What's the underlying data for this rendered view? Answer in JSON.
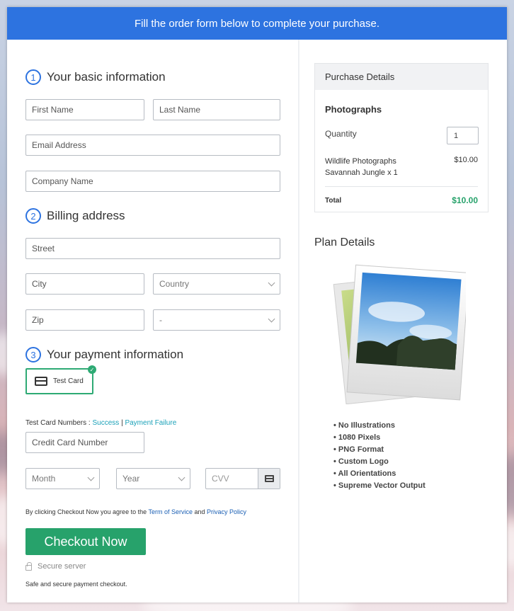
{
  "banner": {
    "text": "Fill the order form below to complete your purchase."
  },
  "sections": {
    "basic": {
      "num": "1",
      "title": "Your basic information"
    },
    "billing": {
      "num": "2",
      "title": "Billing address"
    },
    "payment": {
      "num": "3",
      "title": "Your payment information"
    }
  },
  "fields": {
    "first_name": "First Name",
    "last_name": "Last Name",
    "email": "Email Address",
    "company": "Company Name",
    "street": "Street",
    "city": "City",
    "country": "Country",
    "zip": "Zip",
    "state": "-",
    "card_number": "Credit Card Number",
    "month": "Month",
    "year": "Year",
    "cvv": "CVV"
  },
  "payment": {
    "option_label": "Test Card",
    "test_numbers_label": "Test Card Numbers :",
    "success": "Success",
    "separator": "|",
    "failure": "Payment Failure"
  },
  "agreement": {
    "prefix": "By clicking Checkout Now you agree to the",
    "terms": "Term of Service",
    "and": "and",
    "privacy": "Privacy Policy"
  },
  "checkout_label": "Checkout Now",
  "secure_label": "Secure server",
  "safe_label": "Safe and secure payment checkout.",
  "purchase": {
    "header": "Purchase Details",
    "product": "Photographs",
    "quantity_label": "Quantity",
    "quantity_value": "1",
    "item_line1": "Wildlife Photographs",
    "item_line2": "Savannah Jungle x 1",
    "item_price": "$10.00",
    "total_label": "Total",
    "total_value": "$10.00"
  },
  "plan": {
    "title": "Plan Details",
    "features": [
      "No Illustrations",
      "1080 Pixels",
      "PNG Format",
      "Custom Logo",
      "All Orientations",
      "Supreme Vector Output"
    ]
  },
  "colors": {
    "brand_blue": "#2d73e0",
    "accent_green": "#27a26b",
    "link_teal": "#1aa1b8"
  }
}
